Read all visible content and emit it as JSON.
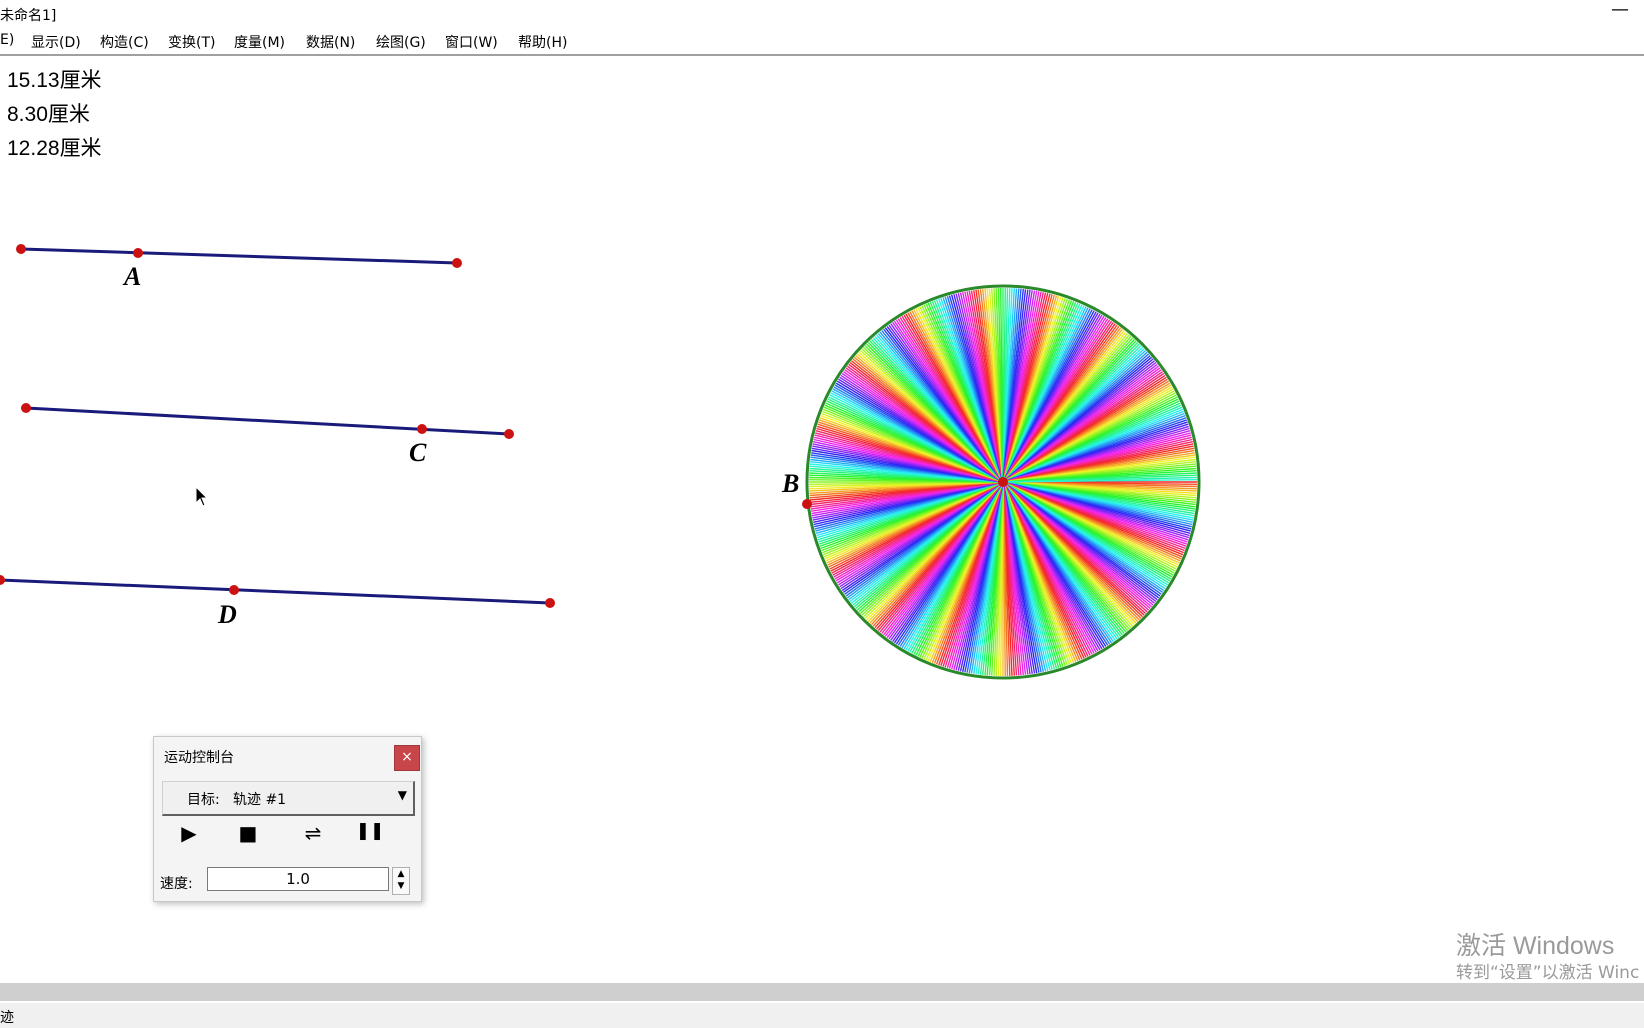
{
  "window": {
    "title": "未命名1]",
    "minimize_glyph": "—"
  },
  "menu": [
    {
      "label": "E)"
    },
    {
      "label": "显示(D)"
    },
    {
      "label": "构造(C)"
    },
    {
      "label": "变换(T)"
    },
    {
      "label": "度量(M)"
    },
    {
      "label": "数据(N)"
    },
    {
      "label": "绘图(G)"
    },
    {
      "label": "窗口(W)"
    },
    {
      "label": "帮助(H)"
    }
  ],
  "measurements": [
    {
      "value": "15.13",
      "unit": "厘米"
    },
    {
      "value": "8.30",
      "unit": "厘米"
    },
    {
      "value": "12.28",
      "unit": "厘米"
    }
  ],
  "points": {
    "a": "A",
    "c": "C",
    "d": "D",
    "b": "B"
  },
  "colors": {
    "segment": "#1a1a7a",
    "point": "#cc1111",
    "circle": "#2a8a2a"
  },
  "motion_panel": {
    "title": "运动控制台",
    "close": "×",
    "target_label": "目标:",
    "target_value": "轨迹 #1",
    "play": "▶",
    "stop": "■",
    "reverse": "⇌",
    "pause": "❚❚",
    "speed_label": "速度:",
    "speed_value": "1.0"
  },
  "status": {
    "text": "迹"
  },
  "watermark": {
    "line1": "激活 Windows",
    "line2": "转到“设置”以激活 Winc"
  }
}
